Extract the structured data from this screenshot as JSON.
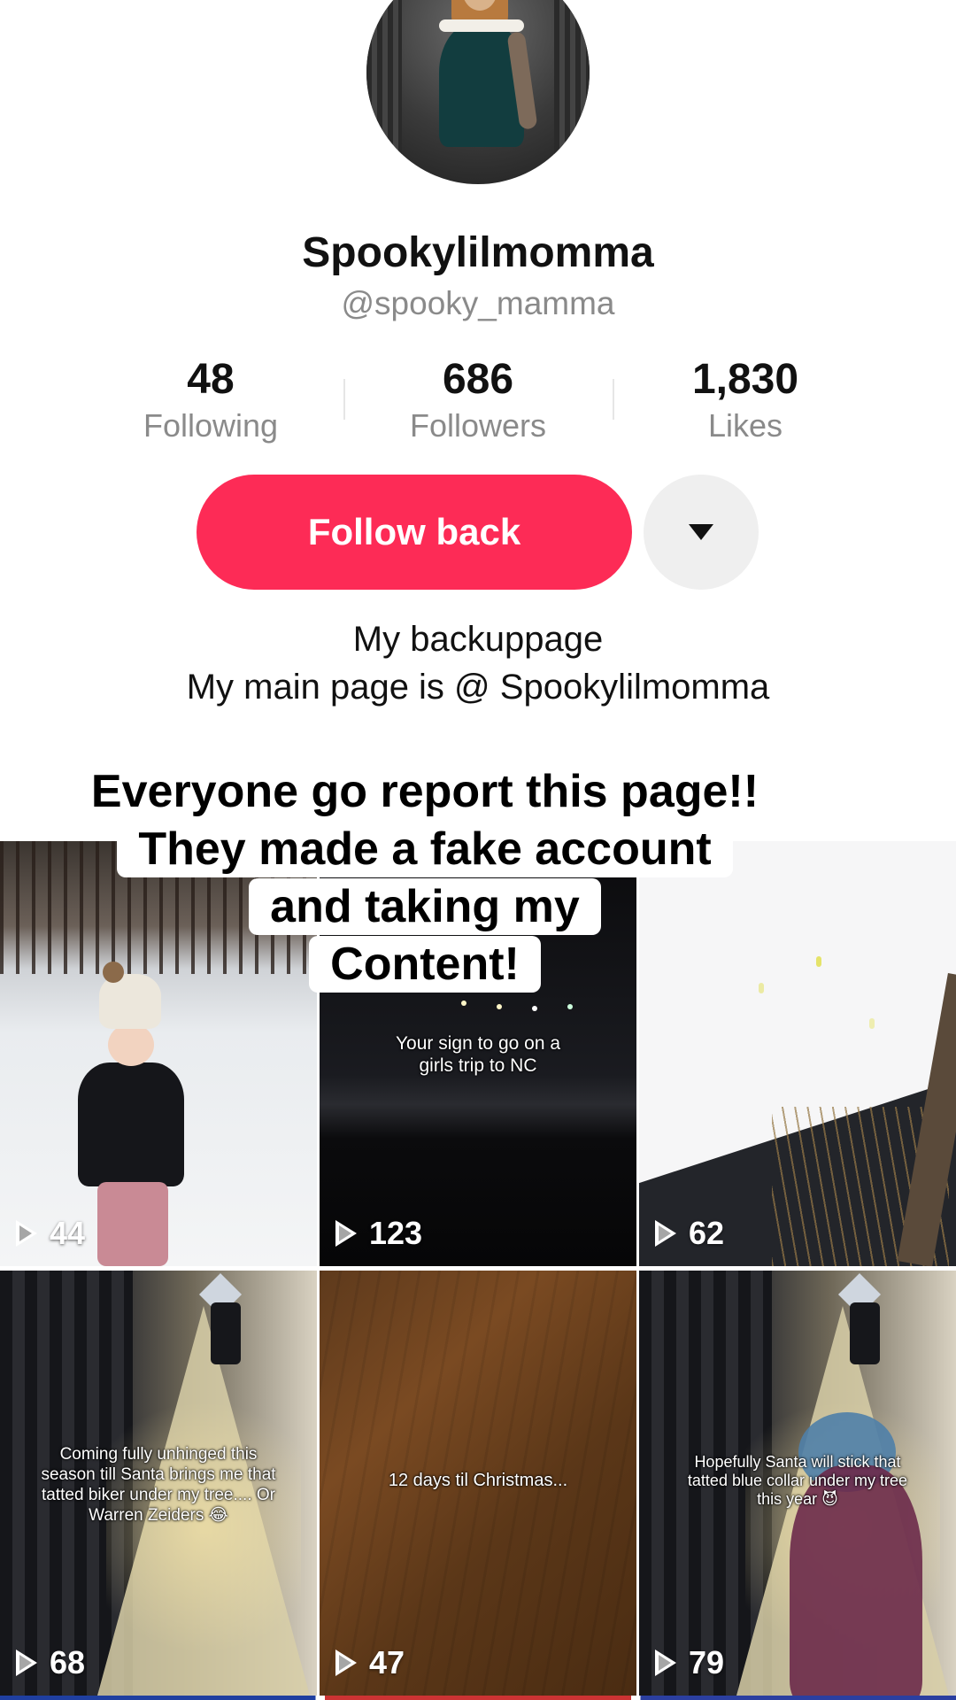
{
  "profile": {
    "display_name": "Spookylilmomma",
    "handle": "@spooky_mamma",
    "bio_line1": "My backuppage",
    "bio_line2": "My main page is @ Spookylilmomma"
  },
  "stats": [
    {
      "value": "48",
      "label": "Following"
    },
    {
      "value": "686",
      "label": "Followers"
    },
    {
      "value": "1,830",
      "label": "Likes"
    }
  ],
  "actions": {
    "follow_label": "Follow back",
    "follow_color": "#fd2b56",
    "more_icon": "chevron-down-icon"
  },
  "overlay": {
    "lines": [
      "Everyone go report this page!!",
      "They made a fake account",
      "and taking my",
      "Content!"
    ]
  },
  "videos": [
    {
      "views": "44",
      "caption": ""
    },
    {
      "views": "123",
      "caption": "Your sign to go on a girls trip to NC"
    },
    {
      "views": "62",
      "caption": ""
    },
    {
      "views": "68",
      "caption": "Coming fully unhinged this season till Santa brings me that tatted biker under my tree.... Or Warren Zeiders 😂"
    },
    {
      "views": "47",
      "caption": "12 days til Christmas..."
    },
    {
      "views": "79",
      "caption": "Hopefully Santa will stick that tatted blue collar under my tree this year 😈"
    }
  ]
}
